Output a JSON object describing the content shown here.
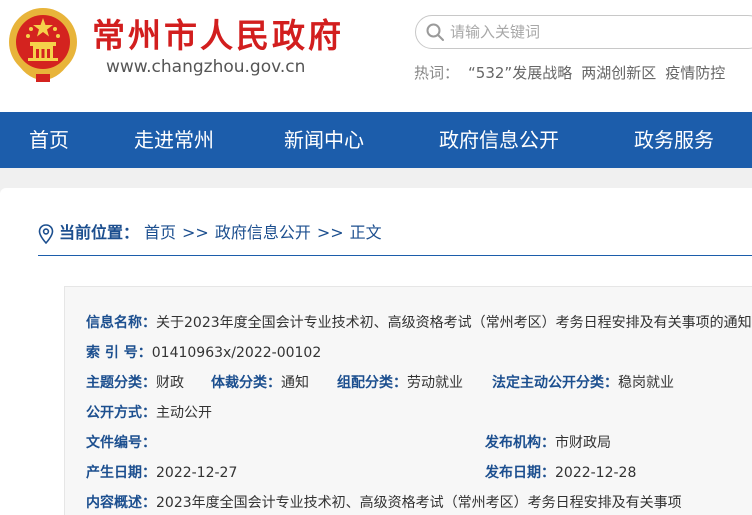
{
  "header": {
    "site_title": "常州市人民政府",
    "site_url": "www.changzhou.gov.cn",
    "emblem_icon": "national-emblem-icon",
    "brand_color": "#d21e1e"
  },
  "search": {
    "placeholder": "请输入关键词",
    "hot_label": "热词：",
    "hot_words": [
      "“532”发展战略",
      "两湖创新区",
      "疫情防控"
    ]
  },
  "nav": {
    "color": "#1c5dab",
    "items": [
      "首页",
      "走进常州",
      "新闻中心",
      "政府信息公开",
      "政务服务"
    ]
  },
  "breadcrumb": {
    "label": "当前位置：",
    "items": [
      "首页",
      "政府信息公开",
      "正文"
    ],
    "separator": ">>"
  },
  "info": {
    "title_label": "信息名称：",
    "title_value": "关于2023年度全国会计专业技术初、高级资格考试（常州考区）考务日程安排及有关事项的通知",
    "index_label": "索 引 号：",
    "index_value": "01410963x/2022-00102",
    "topic_label": "主题分类：",
    "topic_value": "财政",
    "genre_label": "体裁分类：",
    "genre_value": "通知",
    "org_label": "组配分类：",
    "org_value": "劳动就业",
    "statutory_label": "法定主动公开分类：",
    "statutory_value": "稳岗就业",
    "method_label": "公开方式：",
    "method_value": "主动公开",
    "docno_label": "文件编号：",
    "docno_value": "",
    "publisher_label": "发布机构：",
    "publisher_value": "市财政局",
    "created_label": "产生日期：",
    "created_value": "2022-12-27",
    "published_label": "发布日期：",
    "published_value": "2022-12-28",
    "summary_label": "内容概述：",
    "summary_value": "2023年度全国会计专业技术初、高级资格考试（常州考区）考务日程安排及有关事项"
  }
}
